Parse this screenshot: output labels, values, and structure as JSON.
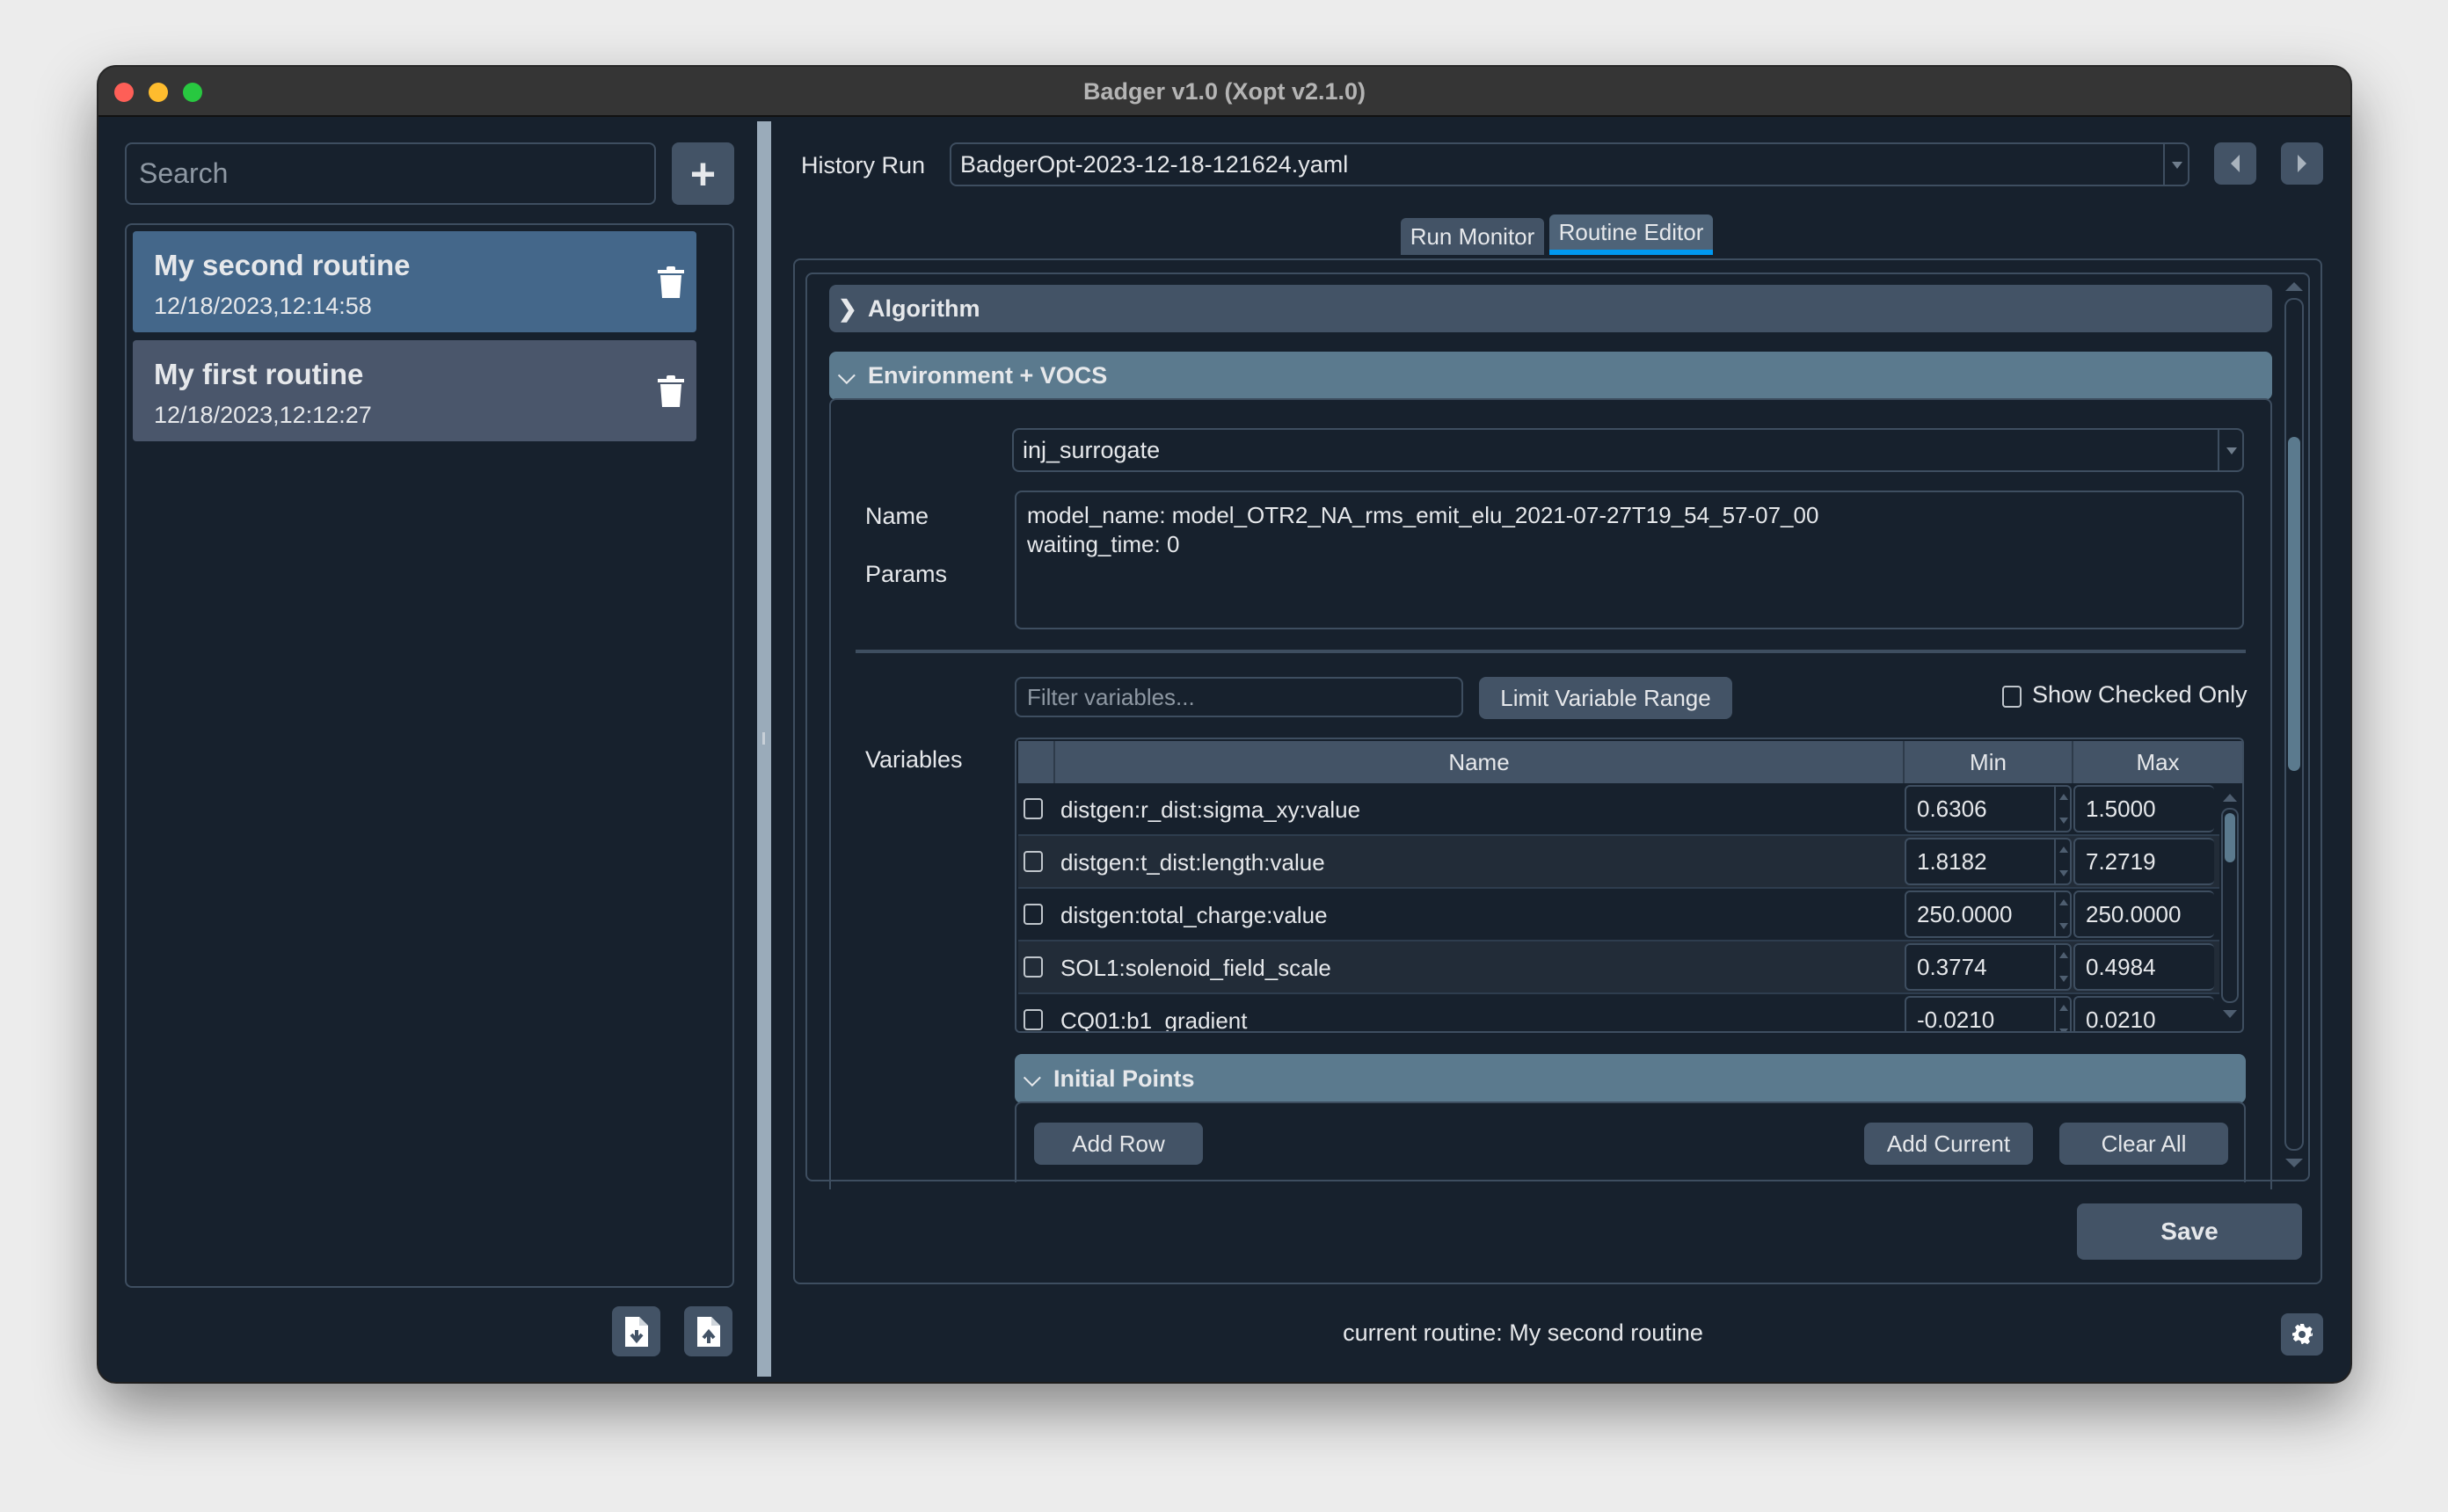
{
  "window": {
    "title": "Badger v1.0 (Xopt v2.1.0)",
    "traffic_lights": {
      "close": "#fe5f57",
      "minimize": "#febc2e",
      "maximize": "#28c840"
    }
  },
  "sidebar": {
    "search_placeholder": "Search",
    "add_icon": "+",
    "routines": [
      {
        "name": "My second routine",
        "timestamp": "12/18/2023,12:14:58",
        "selected": true
      },
      {
        "name": "My first routine",
        "timestamp": "12/18/2023,12:12:27",
        "selected": false
      }
    ],
    "import_icon": "file-import-icon",
    "export_icon": "file-export-icon"
  },
  "history": {
    "label": "History Run",
    "selected_file": "BadgerOpt-2023-12-18-121624.yaml"
  },
  "tabs": [
    {
      "label": "Run Monitor",
      "active": false
    },
    {
      "label": "Routine Editor",
      "active": true
    }
  ],
  "editor": {
    "sections": {
      "algorithm": {
        "title": "Algorithm",
        "expanded": false
      },
      "environment": {
        "title": "Environment + VOCS",
        "expanded": true
      },
      "initial_points": {
        "title": "Initial Points",
        "expanded": true
      }
    },
    "name_label": "Name",
    "name_value": "inj_surrogate",
    "params_label": "Params",
    "params_lines": [
      "model_name: model_OTR2_NA_rms_emit_elu_2021-07-27T19_54_57-07_00",
      "waiting_time: 0"
    ],
    "variables_label": "Variables",
    "filter_placeholder": "Filter variables...",
    "limit_button": "Limit Variable Range",
    "show_checked_label": "Show Checked Only",
    "show_checked": false,
    "table": {
      "columns": [
        "Name",
        "Min",
        "Max"
      ],
      "rows": [
        {
          "checked": false,
          "name": "distgen:r_dist:sigma_xy:value",
          "min": "0.6306",
          "max": "1.5000"
        },
        {
          "checked": false,
          "name": "distgen:t_dist:length:value",
          "min": "1.8182",
          "max": "7.2719"
        },
        {
          "checked": false,
          "name": "distgen:total_charge:value",
          "min": "250.0000",
          "max": "250.0000"
        },
        {
          "checked": false,
          "name": "SOL1:solenoid_field_scale",
          "min": "0.3774",
          "max": "0.4984"
        },
        {
          "checked": false,
          "name": "CQ01:b1_gradient",
          "min": "-0.0210",
          "max": "0.0210"
        }
      ]
    },
    "initial_points_buttons": {
      "add_row": "Add Row",
      "add_current": "Add Current",
      "clear_all": "Clear All"
    },
    "save_button": "Save"
  },
  "status": {
    "text": "current routine: My second routine"
  },
  "colors": {
    "background": "#17212d",
    "button": "#435366",
    "selected_item": "#44678a",
    "item": "#4a566b",
    "section_expanded": "#5b7a8e",
    "tab_underline": "#0098f0"
  }
}
